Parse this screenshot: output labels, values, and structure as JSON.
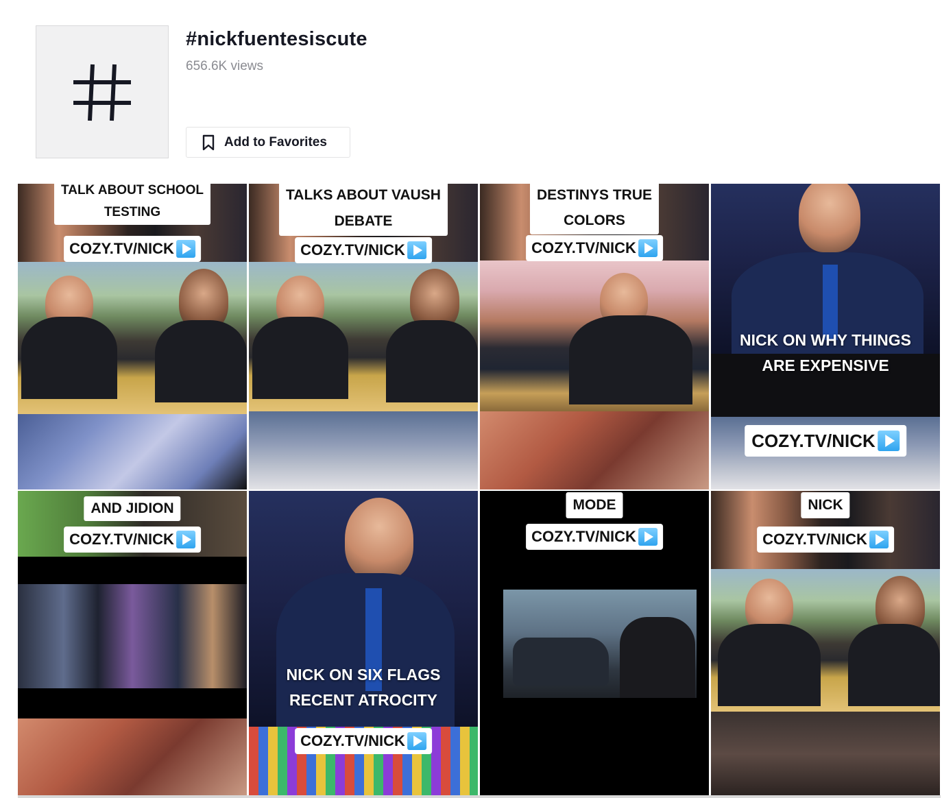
{
  "tag": {
    "title": "#nickfuentesiscute",
    "views": "656.6K views",
    "favorite_label": "Add to Favorites"
  },
  "icons": {
    "hashtag": "hashtag-icon",
    "bookmark": "bookmark-icon",
    "play": "play-icon"
  },
  "videos": [
    {
      "caption": "TALK ABOUT SCHOOL TESTING",
      "caption_lines": [
        "TALK ABOUT SCHOOL",
        "TESTING"
      ],
      "link": "COZY.TV/NICK"
    },
    {
      "caption": "TALKS ABOUT VAUSH DEBATE",
      "caption_lines": [
        "TALKS ABOUT VAUSH",
        "DEBATE"
      ],
      "link": "COZY.TV/NICK"
    },
    {
      "caption": "DESTINYS TRUE COLORS",
      "caption_lines": [
        "DESTINYS TRUE",
        "COLORS"
      ],
      "link": "COZY.TV/NICK"
    },
    {
      "caption": "NICK ON WHY THINGS ARE EXPENSIVE",
      "caption_lines": [
        "NICK ON WHY THINGS",
        "ARE EXPENSIVE"
      ],
      "link": "COZY.TV/NICK"
    },
    {
      "caption": "AND JIDION",
      "caption_lines": [
        "AND JIDION"
      ],
      "link": "COZY.TV/NICK"
    },
    {
      "caption": "NICK ON SIX FLAGS RECENT ATROCITY",
      "caption_lines": [
        "NICK ON SIX FLAGS",
        "RECENT ATROCITY"
      ],
      "link": "COZY.TV/NICK"
    },
    {
      "caption": "MODE",
      "caption_lines": [
        "MODE"
      ],
      "link": "COZY.TV/NICK"
    },
    {
      "caption": "NICK",
      "caption_lines": [
        "NICK"
      ],
      "link": "COZY.TV/NICK"
    }
  ],
  "colors": {
    "text_primary": "#161823",
    "text_secondary": "#8a8b91",
    "border": "#e3e3e4",
    "hash_box_bg": "#f1f1f2",
    "play_badge": "#2fa4ef"
  }
}
